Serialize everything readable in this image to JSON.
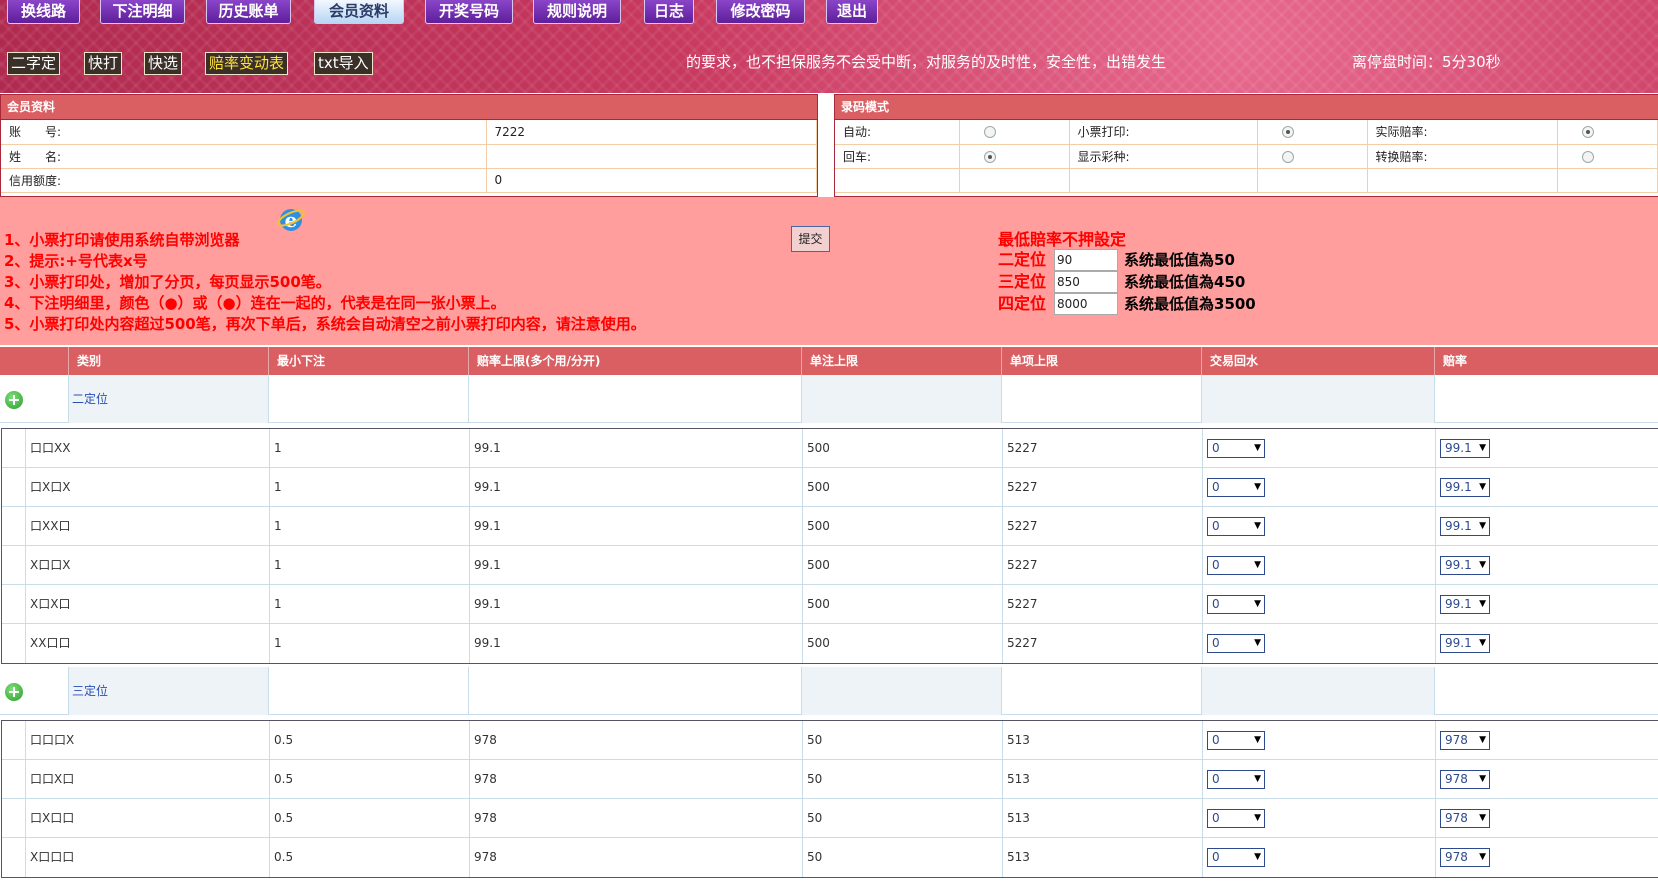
{
  "nav": [
    "换线路",
    "下注明细",
    "历史账单",
    "会员资料",
    "开奖号码",
    "规则说明",
    "日志",
    "修改密码",
    "退出"
  ],
  "nav_active": "会员资料",
  "toolbar": [
    "二字定",
    "快打",
    "快选",
    "赔率变动表",
    "txt导入"
  ],
  "marquee": "的要求，也不担保服务不会受中断，对服务的及时性，安全性，出错发生",
  "countdown": {
    "label": "离停盘时间：",
    "value": "5分30秒"
  },
  "member_panel": {
    "title": "会员资料",
    "rows": [
      {
        "label": "账　　号:",
        "value": "7222"
      },
      {
        "label": "姓　　名:",
        "value": ""
      },
      {
        "label": "信用额度:",
        "value": "0"
      }
    ]
  },
  "input_panel": {
    "title": "录码模式",
    "row1": [
      {
        "label": "自动:",
        "checked": false
      },
      {
        "label": "小票打印:",
        "checked": true
      },
      {
        "label": "实际赔率:",
        "checked": true
      }
    ],
    "row2": [
      {
        "label": "回车:",
        "checked": true
      },
      {
        "label": "显示彩种:",
        "checked": false
      },
      {
        "label": "转换赔率:",
        "checked": false
      }
    ]
  },
  "notes": [
    "1、小票打印请使用系统自带浏览器",
    "2、提示:+号代表x号",
    "3、小票打印处，增加了分页，每页显示500笔。",
    "4、下注明细里，颜色（●）或（●）连在一起的，代表是在同一张小票上。",
    "5、小票打印处内容超过500笔，再次下单后，系统会自动清空之前小票打印内容，请注意使用。"
  ],
  "submit_label": "提交",
  "min_odds": {
    "title": "最低賠率不押設定",
    "rows": [
      {
        "label": "二定位",
        "value": "90",
        "system": "系统最低值為50"
      },
      {
        "label": "三定位",
        "value": "850",
        "system": "系统最低值為450"
      },
      {
        "label": "四定位",
        "value": "8000",
        "system": "系统最低值為3500"
      }
    ]
  },
  "grid": {
    "headers": [
      "类别",
      "最小下注",
      "赔率上限(多个用/分开)",
      "单注上限",
      "单项上限",
      "交易回水",
      "赔率"
    ],
    "groups": [
      {
        "name": "二定位",
        "rows": [
          [
            "口口XX",
            "1",
            "99.1",
            "500",
            "5227",
            "0",
            "99.1"
          ],
          [
            "口X口X",
            "1",
            "99.1",
            "500",
            "5227",
            "0",
            "99.1"
          ],
          [
            "口XX口",
            "1",
            "99.1",
            "500",
            "5227",
            "0",
            "99.1"
          ],
          [
            "X口口X",
            "1",
            "99.1",
            "500",
            "5227",
            "0",
            "99.1"
          ],
          [
            "X口X口",
            "1",
            "99.1",
            "500",
            "5227",
            "0",
            "99.1"
          ],
          [
            "XX口口",
            "1",
            "99.1",
            "500",
            "5227",
            "0",
            "99.1"
          ]
        ]
      },
      {
        "name": "三定位",
        "rows": [
          [
            "口口口X",
            "0.5",
            "978",
            "50",
            "513",
            "0",
            "978"
          ],
          [
            "口口X口",
            "0.5",
            "978",
            "50",
            "513",
            "0",
            "978"
          ],
          [
            "口X口口",
            "0.5",
            "978",
            "50",
            "513",
            "0",
            "978"
          ],
          [
            "X口口口",
            "0.5",
            "978",
            "50",
            "513",
            "0",
            "978"
          ]
        ]
      }
    ]
  }
}
